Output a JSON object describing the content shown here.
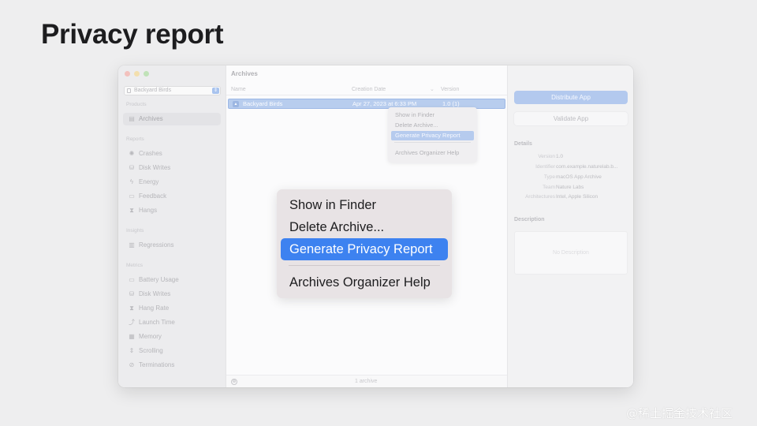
{
  "slide": {
    "title": "Privacy report"
  },
  "sidebar": {
    "scheme_label": "Backyard Birds",
    "sections": [
      {
        "header": "Products",
        "items": [
          {
            "icon": "archive-icon",
            "glyph": "▤",
            "label": "Archives",
            "selected": true
          }
        ]
      },
      {
        "header": "Reports",
        "items": [
          {
            "icon": "crash-icon",
            "glyph": "✺",
            "label": "Crashes"
          },
          {
            "icon": "disk-icon",
            "glyph": "⛁",
            "label": "Disk Writes"
          },
          {
            "icon": "energy-icon",
            "glyph": "ϟ",
            "label": "Energy"
          },
          {
            "icon": "feedback-icon",
            "glyph": "▭",
            "label": "Feedback"
          },
          {
            "icon": "hourglass-icon",
            "glyph": "⧗",
            "label": "Hangs"
          }
        ]
      },
      {
        "header": "Insights",
        "items": [
          {
            "icon": "chart-icon",
            "glyph": "▥",
            "label": "Regressions"
          }
        ]
      },
      {
        "header": "Metrics",
        "items": [
          {
            "icon": "battery-icon",
            "glyph": "▭",
            "label": "Battery Usage"
          },
          {
            "icon": "disk-icon",
            "glyph": "⛁",
            "label": "Disk Writes"
          },
          {
            "icon": "hang-rate-icon",
            "glyph": "⧗",
            "label": "Hang Rate"
          },
          {
            "icon": "launch-icon",
            "glyph": "⤴",
            "label": "Launch Time"
          },
          {
            "icon": "memory-icon",
            "glyph": "▦",
            "label": "Memory"
          },
          {
            "icon": "scroll-icon",
            "glyph": "⇕",
            "label": "Scrolling"
          },
          {
            "icon": "termination-icon",
            "glyph": "⊘",
            "label": "Terminations"
          }
        ]
      }
    ]
  },
  "main": {
    "title": "Archives",
    "columns": {
      "name": "Name",
      "creation_date": "Creation Date",
      "version": "Version"
    },
    "rows": [
      {
        "name": "Backyard Birds",
        "date": "Apr 27, 2023 at 6:33 PM",
        "version": "1.0 (1)"
      }
    ],
    "footer_count": "1 archive"
  },
  "context_menu": {
    "items": [
      "Show in Finder",
      "Delete Archive...",
      "Generate Privacy Report"
    ],
    "highlighted_index": 2,
    "help_item": "Archives Organizer Help"
  },
  "inspector": {
    "distribute_label": "Distribute App",
    "validate_label": "Validate App",
    "details_header": "Details",
    "details": [
      {
        "key": "Version",
        "value": "1.0"
      },
      {
        "key": "Identifier",
        "value": "com.example.naturelab.b..."
      },
      {
        "key": "Type",
        "value": "macOS App Archive"
      },
      {
        "key": "Team",
        "value": "Nature Labs"
      },
      {
        "key": "Architectures",
        "value": "Intel, Apple Silicon"
      }
    ],
    "description_header": "Description",
    "description_placeholder": "No Description"
  },
  "big_menu": {
    "items": [
      "Show in Finder",
      "Delete Archive...",
      "Generate Privacy Report"
    ],
    "highlighted_index": 2,
    "help_item": "Archives Organizer Help"
  },
  "watermark": "@稀土掘金技术社区",
  "colors": {
    "accent": "#3d82f0",
    "background": "#eeeeef"
  }
}
